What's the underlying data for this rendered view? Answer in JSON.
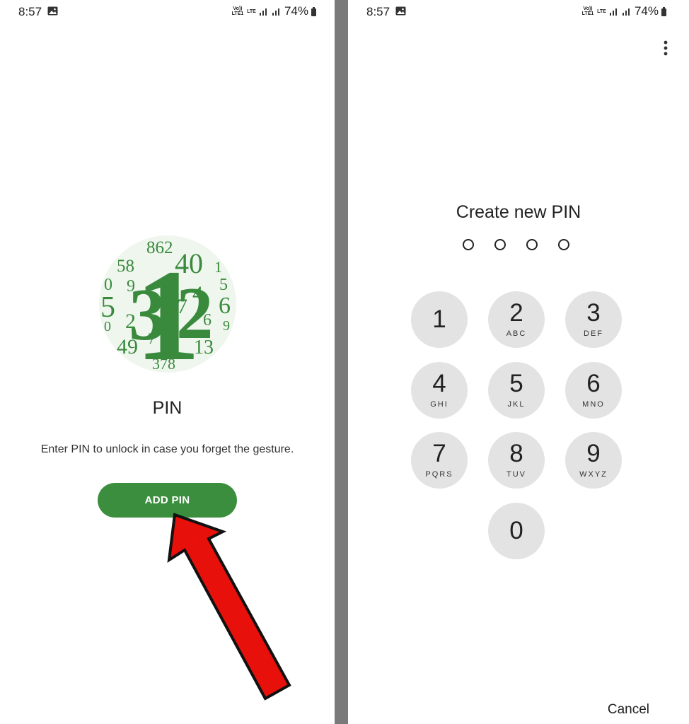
{
  "left": {
    "status": {
      "time": "8:57",
      "volte": "Vo)) LTE1",
      "network": "LTE",
      "battery": "74%"
    },
    "title": "PIN",
    "description": "Enter PIN to unlock in case you forget the gesture.",
    "add_pin_label": "ADD PIN"
  },
  "right": {
    "status": {
      "time": "8:57",
      "volte": "Vo)) LTE1",
      "network": "LTE",
      "battery": "74%"
    },
    "title": "Create new PIN",
    "keypad": [
      {
        "digit": "1",
        "letters": ""
      },
      {
        "digit": "2",
        "letters": "ABC"
      },
      {
        "digit": "3",
        "letters": "DEF"
      },
      {
        "digit": "4",
        "letters": "GHI"
      },
      {
        "digit": "5",
        "letters": "JKL"
      },
      {
        "digit": "6",
        "letters": "MNO"
      },
      {
        "digit": "7",
        "letters": "PQRS"
      },
      {
        "digit": "8",
        "letters": "TUV"
      },
      {
        "digit": "9",
        "letters": "WXYZ"
      },
      {
        "digit": "0",
        "letters": ""
      }
    ],
    "cancel_label": "Cancel"
  },
  "colors": {
    "accent_green": "#3c8e3f",
    "key_background": "#e3e3e3",
    "arrow_red": "#e8100a",
    "divider_gray": "#7a7a7a"
  }
}
